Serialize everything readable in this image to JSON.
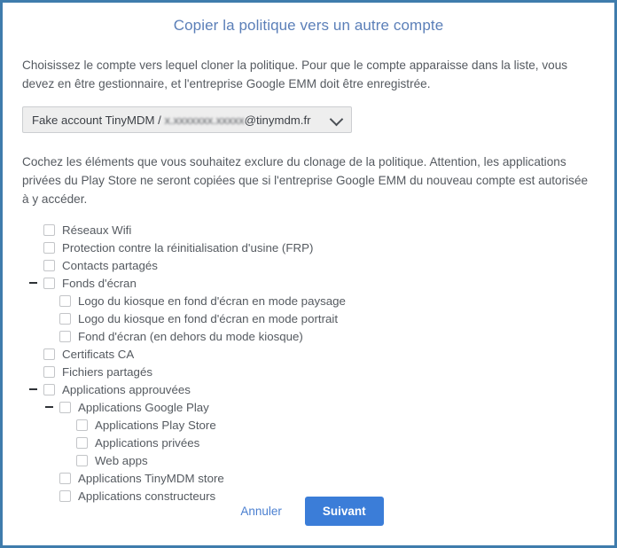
{
  "dialog": {
    "title": "Copier la politique vers un autre compte",
    "intro_text": "Choisissez le compte vers lequel cloner la politique. Pour que le compte apparaisse dans la liste, vous devez en être gestionnaire, et l'entreprise Google EMM doit être enregistrée.",
    "instructions_text": "Cochez les éléments que vous souhaitez exclure du clonage de la politique. Attention, les applications privées du Play Store ne seront copiées que si l'entreprise Google EMM du nouveau compte est autorisée à y accéder.",
    "border_color": "#3f7cac",
    "title_color": "#5b7fb8"
  },
  "account_select": {
    "name": "account-select",
    "prefix": "Fake account TinyMDM / ",
    "redacted_value": "x.xxxxxxx.xxxxx",
    "suffix": "@tinymdm.fr",
    "chevron_icon": "chevron-down-icon"
  },
  "tree": {
    "items": [
      {
        "label": "Réseaux Wifi",
        "level": 0,
        "checked": false,
        "expander": false
      },
      {
        "label": "Protection contre la réinitialisation d'usine (FRP)",
        "level": 0,
        "checked": false,
        "expander": false
      },
      {
        "label": "Contacts partagés",
        "level": 0,
        "checked": false,
        "expander": false
      },
      {
        "label": "Fonds d'écran",
        "level": 0,
        "checked": false,
        "expander": true
      },
      {
        "label": "Logo du kiosque en fond d'écran en mode paysage",
        "level": 1,
        "checked": false,
        "expander": false
      },
      {
        "label": "Logo du kiosque en fond d'écran en mode portrait",
        "level": 1,
        "checked": false,
        "expander": false
      },
      {
        "label": "Fond d'écran (en dehors du mode kiosque)",
        "level": 1,
        "checked": false,
        "expander": false
      },
      {
        "label": "Certificats CA",
        "level": 0,
        "checked": false,
        "expander": false
      },
      {
        "label": "Fichiers partagés",
        "level": 0,
        "checked": false,
        "expander": false
      },
      {
        "label": "Applications approuvées",
        "level": 0,
        "checked": false,
        "expander": true
      },
      {
        "label": "Applications Google Play",
        "level": 1,
        "checked": false,
        "expander": true
      },
      {
        "label": "Applications Play Store",
        "level": 2,
        "checked": false,
        "expander": false
      },
      {
        "label": "Applications privées",
        "level": 2,
        "checked": false,
        "expander": false
      },
      {
        "label": "Web apps",
        "level": 2,
        "checked": false,
        "expander": false
      },
      {
        "label": "Applications TinyMDM store",
        "level": 1,
        "checked": false,
        "expander": false
      },
      {
        "label": "Applications constructeurs",
        "level": 1,
        "checked": false,
        "expander": false
      }
    ]
  },
  "footer": {
    "cancel_label": "Annuler",
    "next_label": "Suivant",
    "cancel_color": "#4a7fd0",
    "next_bg": "#3b7dd8"
  }
}
